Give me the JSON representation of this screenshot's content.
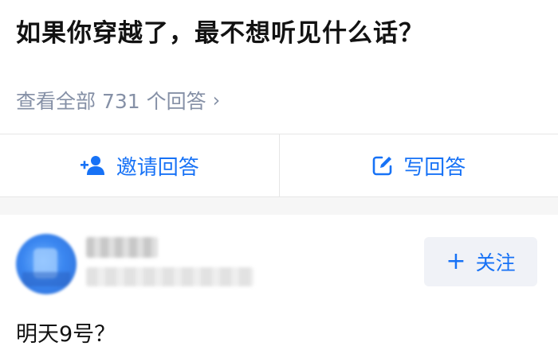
{
  "question": {
    "title": "如果你穿越了，最不想听见什么话？",
    "view_all": "查看全部 731 个回答",
    "view_all_chevron": "›"
  },
  "actions": {
    "invite_label": "邀请回答",
    "invite_icon": "add-person-icon",
    "write_label": "写回答",
    "write_icon": "edit-icon",
    "accent_color": "#1772f6"
  },
  "answer": {
    "follow_label": "关注",
    "follow_plus": "+",
    "content": "明天9号？"
  }
}
